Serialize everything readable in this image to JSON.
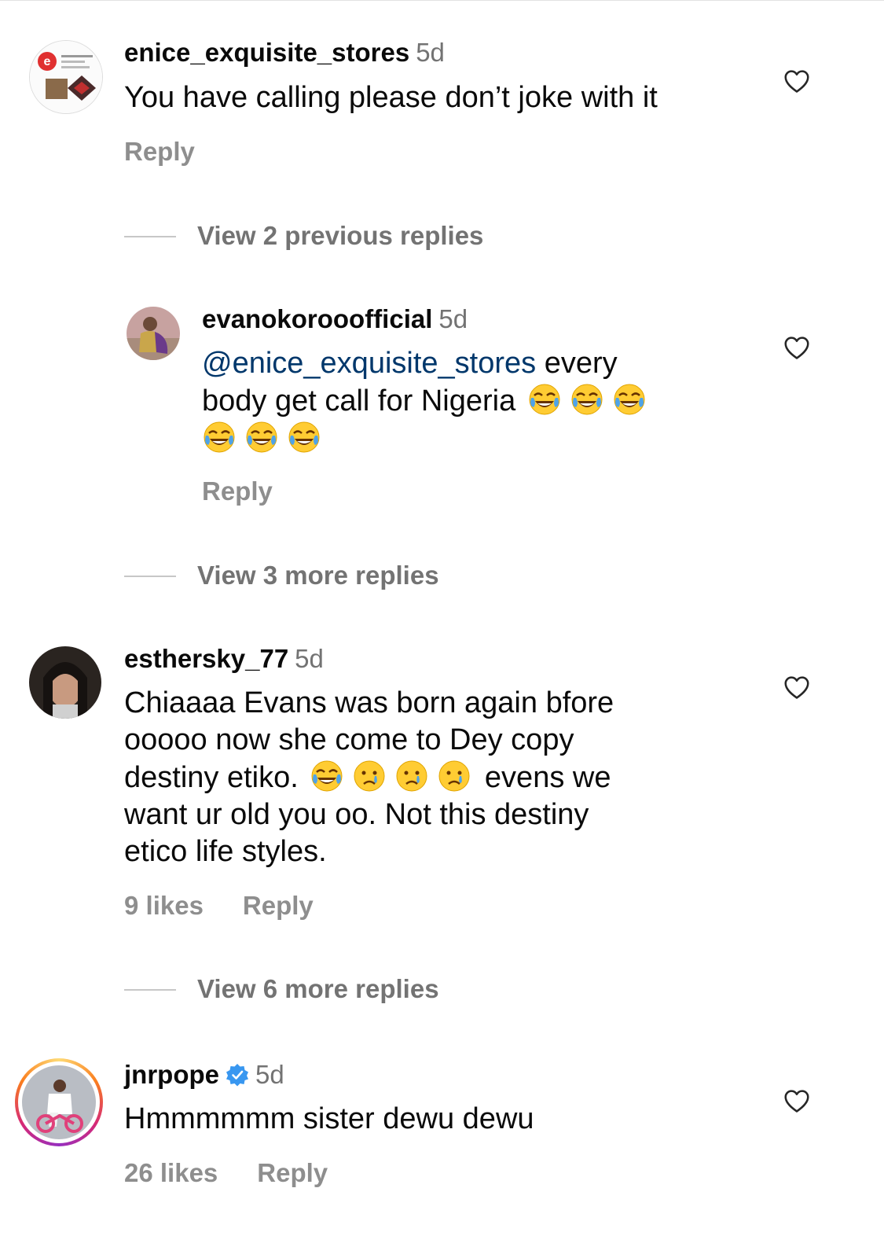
{
  "colors": {
    "mention": "#00376b",
    "muted": "#737373",
    "verified": "#3897f0"
  },
  "comments": [
    {
      "username": "enice_exquisite_stores",
      "time": "5d",
      "text": "You have calling please don’t joke with it",
      "reply_label": "Reply",
      "like_icon": "heart-outline-icon",
      "view_replies": "View 2 previous replies",
      "replies": [
        {
          "username": "evanokorooofficial",
          "time": "5d",
          "mention": "@enice_exquisite_stores",
          "text_line1": " every",
          "text_line2": "body get call for Nigeria",
          "emoji": "face-with-tears-of-joy",
          "reply_label": "Reply"
        }
      ]
    },
    {
      "view_replies": "View 3 more replies"
    },
    {
      "username": "esthersky_77",
      "time": "5d",
      "line1": "Chiaaaa Evans was born again bfore",
      "line2": "ooooo now she come to Dey copy",
      "line3a": "destiny etiko.",
      "line3b": "evens we",
      "line4": "want ur old you oo.  Not this destiny",
      "line5": "etico life styles.",
      "likes": "9 likes",
      "reply_label": "Reply",
      "view_replies": "View 6 more replies"
    },
    {
      "username": "jnrpope",
      "verified": true,
      "time": "5d",
      "text": "Hmmmmmm sister dewu dewu",
      "likes": "26 likes",
      "reply_label": "Reply"
    }
  ]
}
